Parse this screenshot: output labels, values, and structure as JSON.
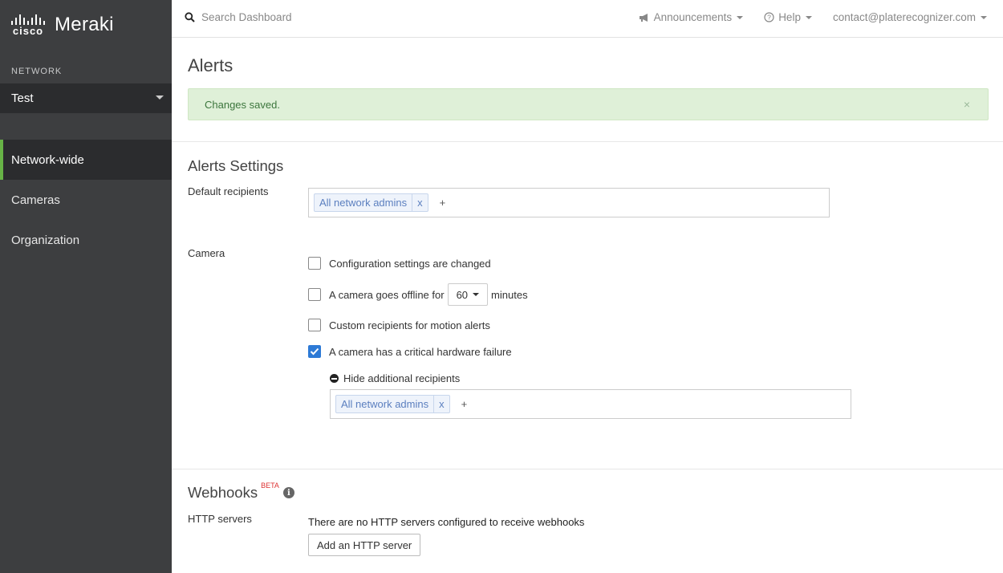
{
  "brand": {
    "cisco": "cisco",
    "meraki": "Meraki"
  },
  "sidebar": {
    "network_label": "NETWORK",
    "network_value": "Test",
    "items": [
      {
        "label": "Network-wide",
        "active": true
      },
      {
        "label": "Cameras",
        "active": false
      },
      {
        "label": "Organization",
        "active": false
      }
    ]
  },
  "topbar": {
    "search_placeholder": "Search Dashboard",
    "announcements": "Announcements",
    "help": "Help",
    "account": "contact@platerecognizer.com"
  },
  "page": {
    "title": "Alerts",
    "alert_message": "Changes saved.",
    "alert_close": "×"
  },
  "alerts_settings": {
    "title": "Alerts Settings",
    "default_recipients_label": "Default recipients",
    "default_recipients": [
      {
        "text": "All network admins",
        "remove": "x"
      }
    ],
    "add": "+"
  },
  "camera": {
    "label": "Camera",
    "options": [
      {
        "label": "Configuration settings are changed",
        "checked": false
      },
      {
        "label_before": "A camera goes offline for",
        "value": "60",
        "label_after": "minutes",
        "checked": false
      },
      {
        "label": "Custom recipients for motion alerts",
        "checked": false
      },
      {
        "label": "A camera has a critical hardware failure",
        "checked": true
      }
    ],
    "hide_recipients": "Hide additional recipients",
    "extra_recipients": [
      {
        "text": "All network admins",
        "remove": "x"
      }
    ],
    "add": "+"
  },
  "webhooks": {
    "title": "Webhooks",
    "badge": "BETA",
    "info": "i",
    "http_label": "HTTP servers",
    "http_text": "There are no HTTP servers configured to receive webhooks",
    "add_button": "Add an HTTP server"
  },
  "colors": {
    "sidebar_bg": "#3d3e40",
    "active_accent": "#67b346",
    "success_bg": "#dff0d8",
    "checkbox_blue": "#2d7ad6",
    "tag_text": "#5b7fbf"
  }
}
